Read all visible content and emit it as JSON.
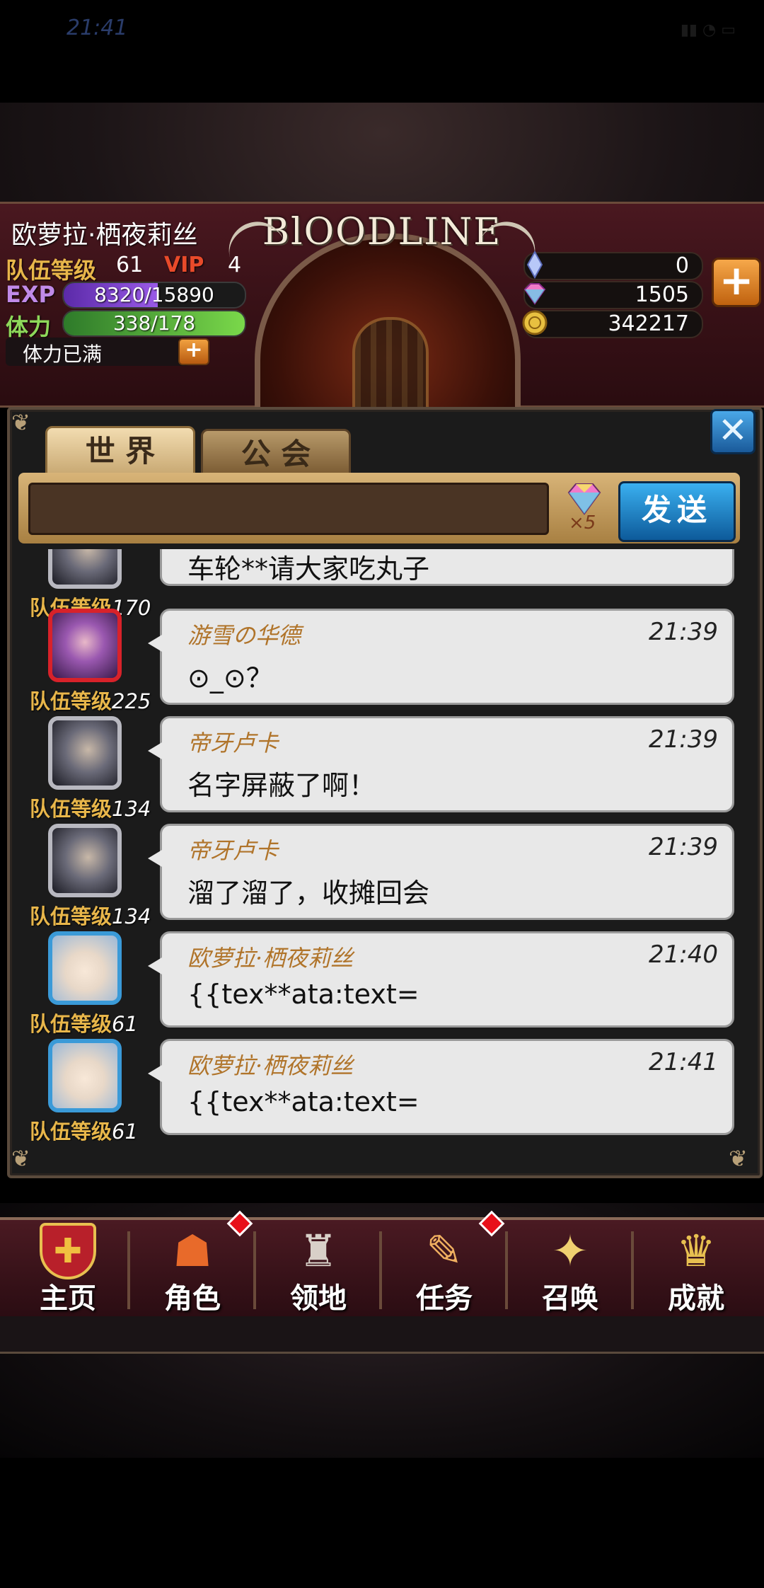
{
  "status_bar": {
    "time": "21:41",
    "icons": "▮▮ ◔ ▭"
  },
  "header": {
    "logo": "BlOODLINE",
    "player_name": "欧萝拉·栖夜莉丝",
    "team_level_label": "队伍等级",
    "team_level": "61",
    "vip_label": "VIP",
    "vip_level": "4",
    "exp_label": "EXP",
    "exp_value": "8320/15890",
    "exp_fraction": 0.52,
    "stamina_label": "体力",
    "stamina_value": "338/178",
    "stamina_fraction": 1.0,
    "stamina_full_text": "体力已满",
    "plus_symbol": "+",
    "currencies": [
      {
        "icon": "crystal-icon",
        "value": "0"
      },
      {
        "icon": "gem-icon",
        "value": "1505"
      },
      {
        "icon": "gold-coin-icon",
        "value": "342217"
      }
    ]
  },
  "chat": {
    "tabs": [
      {
        "label": "世 界",
        "active": true
      },
      {
        "label": "公 会",
        "active": false
      }
    ],
    "input": {
      "value": "",
      "placeholder": ""
    },
    "gem_cost": "×5",
    "send_label": "发送",
    "close_symbol": "✕",
    "messages": [
      {
        "level_label": "队伍等级",
        "level": "170",
        "name": "",
        "time": "",
        "text": "车轮**请大家吃丸子",
        "avatar": "silver"
      },
      {
        "level_label": "队伍等级",
        "level": "225",
        "name": "游雪の华德",
        "time": "21:39",
        "text": "⊙_⊙？",
        "avatar": "purple"
      },
      {
        "level_label": "队伍等级",
        "level": "134",
        "name": "帝牙卢卡",
        "time": "21:39",
        "text": "名字屏蔽了啊！",
        "avatar": "silver"
      },
      {
        "level_label": "队伍等级",
        "level": "134",
        "name": "帝牙卢卡",
        "time": "21:39",
        "text": "溜了溜了，收摊回会",
        "avatar": "silver"
      },
      {
        "level_label": "队伍等级",
        "level": "61",
        "name": "欧萝拉·栖夜莉丝",
        "time": "21:40",
        "text": "{{tex**ata:text=",
        "avatar": "blue"
      },
      {
        "level_label": "队伍等级",
        "level": "61",
        "name": "欧萝拉·栖夜莉丝",
        "time": "21:41",
        "text": "{{tex**ata:text=",
        "avatar": "blue"
      }
    ]
  },
  "nav": [
    {
      "label": "主页",
      "icon": "shield-cross-icon",
      "glyph": "✚",
      "badge": false
    },
    {
      "label": "角色",
      "icon": "hooded-character-icon",
      "glyph": "☗",
      "badge": true
    },
    {
      "label": "领地",
      "icon": "castle-icon",
      "glyph": "♜",
      "badge": false
    },
    {
      "label": "任务",
      "icon": "quest-book-icon",
      "glyph": "✎",
      "badge": true
    },
    {
      "label": "召唤",
      "icon": "summon-cards-icon",
      "glyph": "✦",
      "badge": false
    },
    {
      "label": "成就",
      "icon": "trophy-icon",
      "glyph": "♛",
      "badge": false
    }
  ],
  "colors": {
    "accent_gold": "#e8b64a",
    "send_blue": "#1a7ac8",
    "close_blue": "#2a7ab8",
    "badge_red": "#e8101a"
  }
}
